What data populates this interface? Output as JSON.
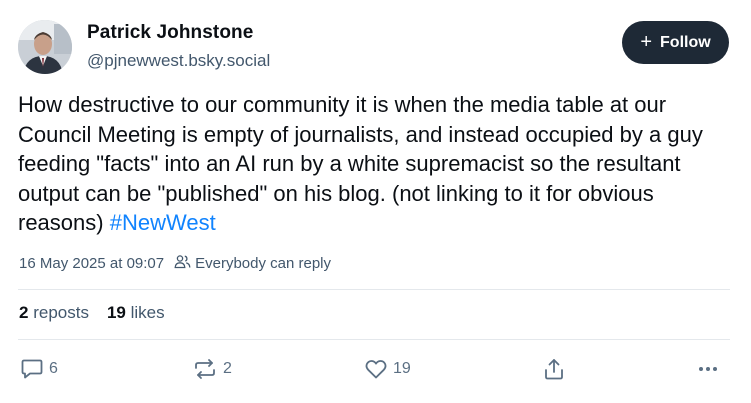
{
  "author": {
    "name": "Patrick Johnstone",
    "handle": "@pjnewwest.bsky.social"
  },
  "follow_button": {
    "label": "Follow",
    "icon": "plus-icon"
  },
  "post": {
    "text": "How destructive to our community it is when the media table at our Council Meeting is empty of journalists, and instead occupied by a guy feeding \"facts\" into an AI run by a white supremacist so the resultant output can be \"published\" on his blog. (not linking to it for obvious reasons) ",
    "hashtag": "#NewWest",
    "timestamp": "16 May 2025 at 09:07",
    "reply_setting": "Everybody can reply"
  },
  "stats": {
    "reposts_count": "2",
    "reposts_label": "reposts",
    "likes_count": "19",
    "likes_label": "likes"
  },
  "actions": {
    "reply_count": "6",
    "repost_count": "2",
    "like_count": "19"
  },
  "colors": {
    "text": "#0b0f14",
    "muted": "#42576c",
    "link": "#1083fe",
    "follow_bg": "#1e2936",
    "divider": "#e4e8ec"
  }
}
